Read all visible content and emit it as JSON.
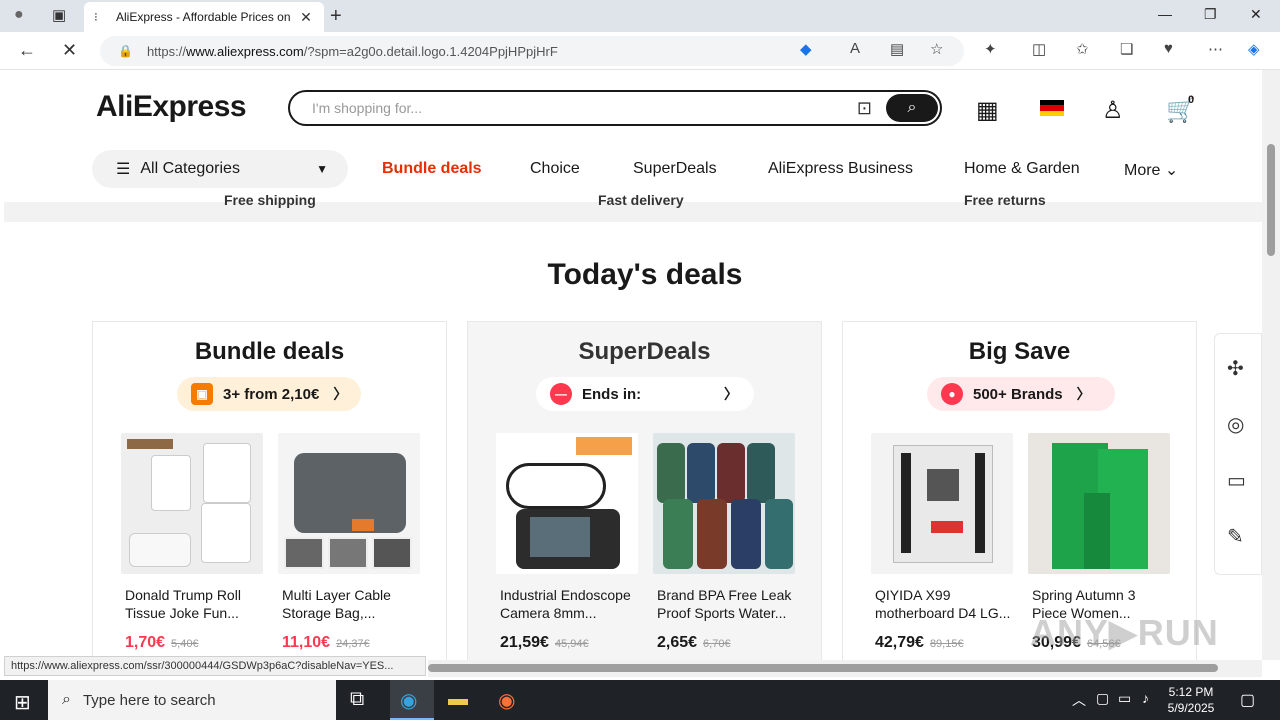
{
  "browser": {
    "tab_title": "AliExpress - Affordable Prices on",
    "url_prefix": "https://",
    "url_host": "www.aliexpress.com",
    "url_rest": "/?spm=a2g0o.detail.logo.1.4204PpjHPpjHrF",
    "status_url": "https://www.aliexpress.com/ssr/300000444/GSDWp3p6aC?disableNav=YES..."
  },
  "header": {
    "logo": "AliExpress",
    "search_placeholder": "I'm shopping for...",
    "cart_count": "0"
  },
  "nav": {
    "categories_label": "All Categories",
    "links": [
      "Bundle deals",
      "Choice",
      "SuperDeals",
      "AliExpress Business",
      "Home & Garden",
      "More"
    ]
  },
  "strip": [
    "Free shipping",
    "Fast delivery",
    "Free returns"
  ],
  "main": {
    "heading": "Today's deals",
    "cards": [
      {
        "title": "Bundle deals",
        "pill": "3+ from 2,10€",
        "products": [
          {
            "name1": "Donald Trump Roll",
            "name2": "Tissue Joke Fun...",
            "price": "1,70€",
            "old": "5,40€"
          },
          {
            "name1": "Multi Layer Cable",
            "name2": "Storage Bag,...",
            "price": "11,10€",
            "old": "24,37€"
          }
        ]
      },
      {
        "title": "SuperDeals",
        "pill": "Ends in:",
        "products": [
          {
            "name1": "Industrial Endoscope",
            "name2": "Camera 8mm...",
            "price": "21,59€",
            "old": "45,94€"
          },
          {
            "name1": "Brand BPA Free Leak",
            "name2": "Proof Sports Water...",
            "price": "2,65€",
            "old": "6,70€"
          }
        ]
      },
      {
        "title": "Big Save",
        "pill": "500+ Brands",
        "products": [
          {
            "name1": "QIYIDA X99",
            "name2": "motherboard D4 LG...",
            "price": "42,79€",
            "old": "89,15€"
          },
          {
            "name1": "Spring Autumn 3",
            "name2": "Piece Women...",
            "price": "30,99€",
            "old": "64,56€"
          }
        ]
      }
    ]
  },
  "taskbar": {
    "search_placeholder": "Type here to search",
    "time": "5:12 PM",
    "date": "5/9/2025"
  },
  "colors": {
    "accent_red": "#e62e04",
    "price_red": "#fd384f",
    "dark": "#191919"
  }
}
